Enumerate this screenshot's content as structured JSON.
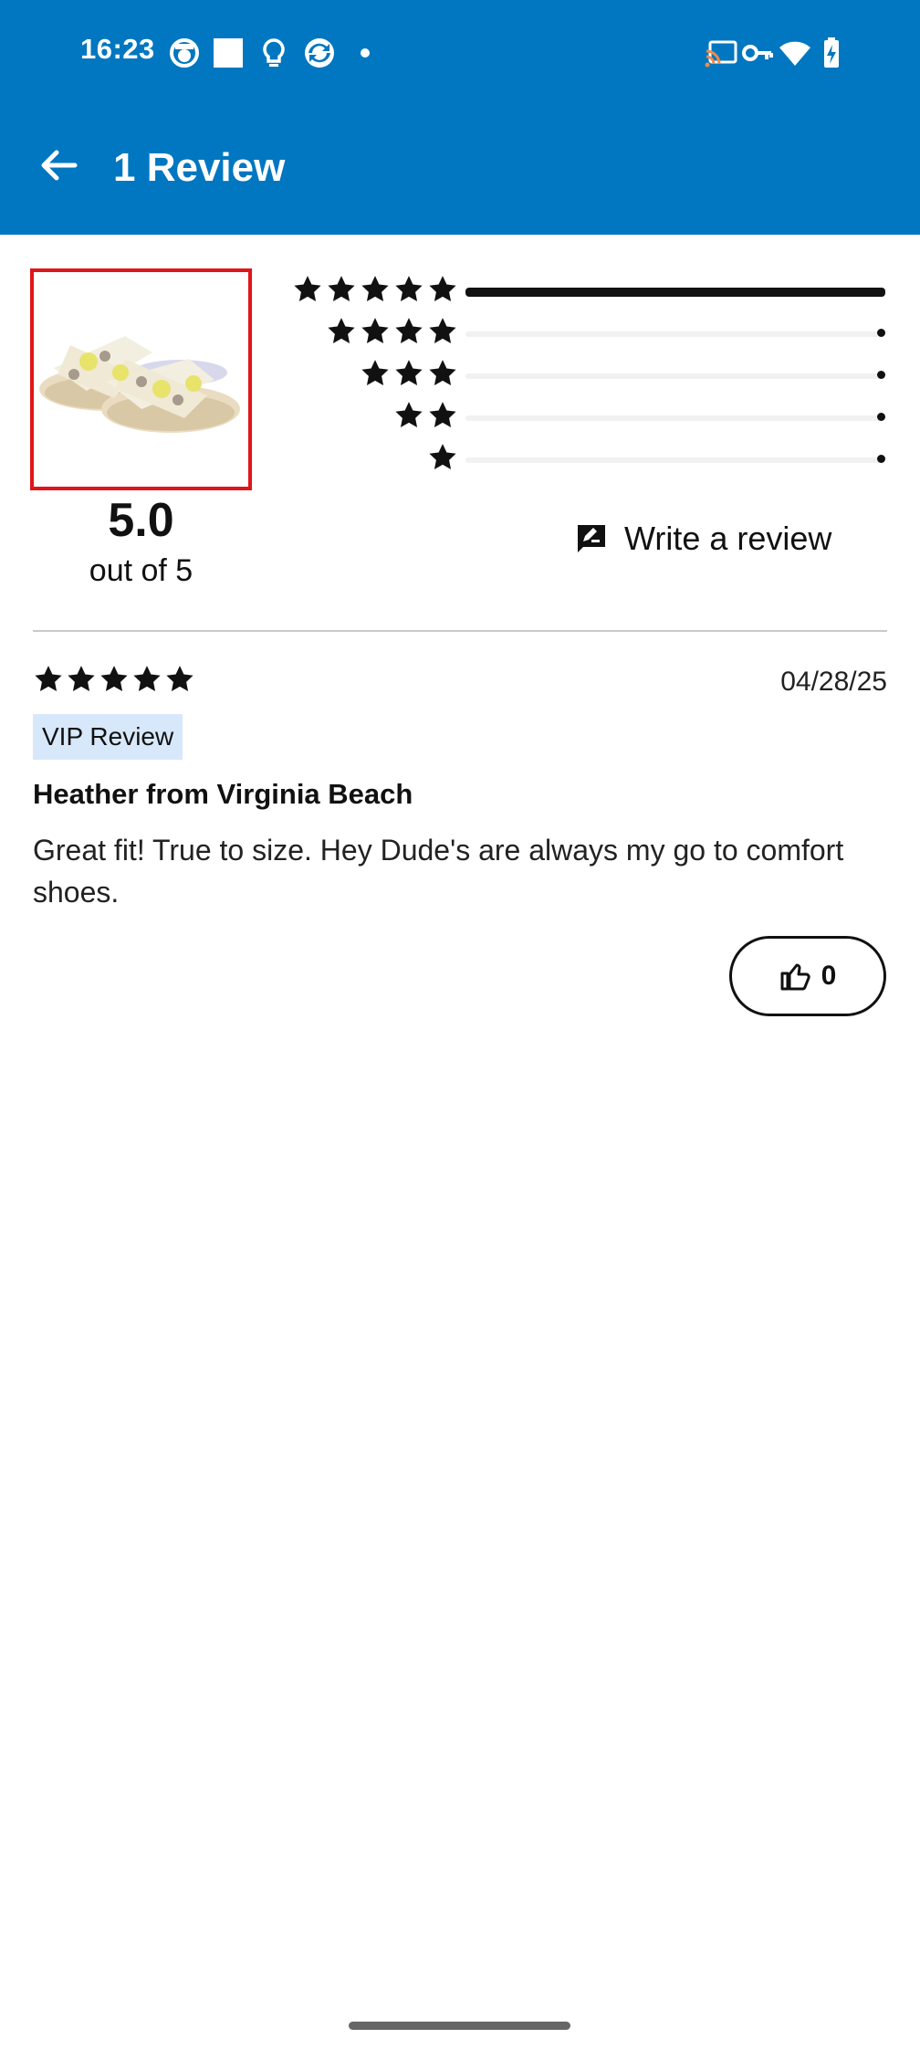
{
  "status_bar": {
    "time": "16:23",
    "left_icons": [
      "face-icon",
      "square-icon",
      "bulb-icon",
      "sync-icon",
      "dot-icon"
    ],
    "right_icons": [
      "cast-icon",
      "vpn-key-icon",
      "wifi-icon",
      "battery-charging-icon"
    ]
  },
  "app_bar": {
    "back_icon": "arrow-back-icon",
    "title": "1 Review",
    "background": "#0077c0"
  },
  "summary": {
    "average": "5.0",
    "out_of": "out of 5",
    "histogram": [
      {
        "stars": 5,
        "fraction": 1.0
      },
      {
        "stars": 4,
        "fraction": 0.0
      },
      {
        "stars": 3,
        "fraction": 0.0
      },
      {
        "stars": 2,
        "fraction": 0.0
      },
      {
        "stars": 1,
        "fraction": 0.0
      }
    ],
    "write_review_label": "Write a review",
    "write_review_icon": "rate-review-icon"
  },
  "review": {
    "rating": 5,
    "date": "04/28/25",
    "badge": "VIP Review",
    "reviewer": "Heather from Virginia Beach",
    "text": "Great fit! True to size.  Hey Dude's are always my go to comfort shoes.",
    "helpful_icon": "thumbs-up-icon",
    "helpful_count": "0"
  },
  "colors": {
    "accent": "#0077c0",
    "thumb_border": "#e0151a",
    "badge_bg": "#d8e8fb"
  }
}
